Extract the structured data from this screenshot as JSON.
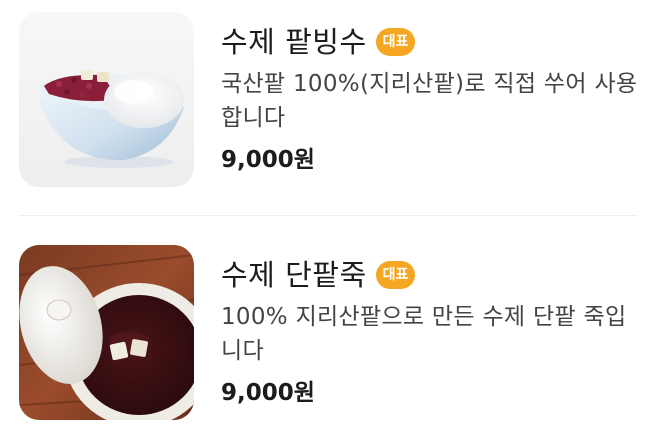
{
  "menu": {
    "items": [
      {
        "name": "수제 팥빙수",
        "badge": "대표",
        "description": "국산팥 100%(지리산팥)로 직접 쑤어 사용합니다",
        "price": "9,000원",
        "image": "patbingsu-photo"
      },
      {
        "name": "수제 단팥죽",
        "badge": "대표",
        "description": "100% 지리산팥으로 만든 수제 단팥 죽입니다",
        "price": "9,000원",
        "image": "danpatjuk-photo"
      }
    ]
  },
  "colors": {
    "badge": "#f5a623",
    "text": "#1c1c1c",
    "description": "#444444",
    "divider": "#eeeeee"
  }
}
